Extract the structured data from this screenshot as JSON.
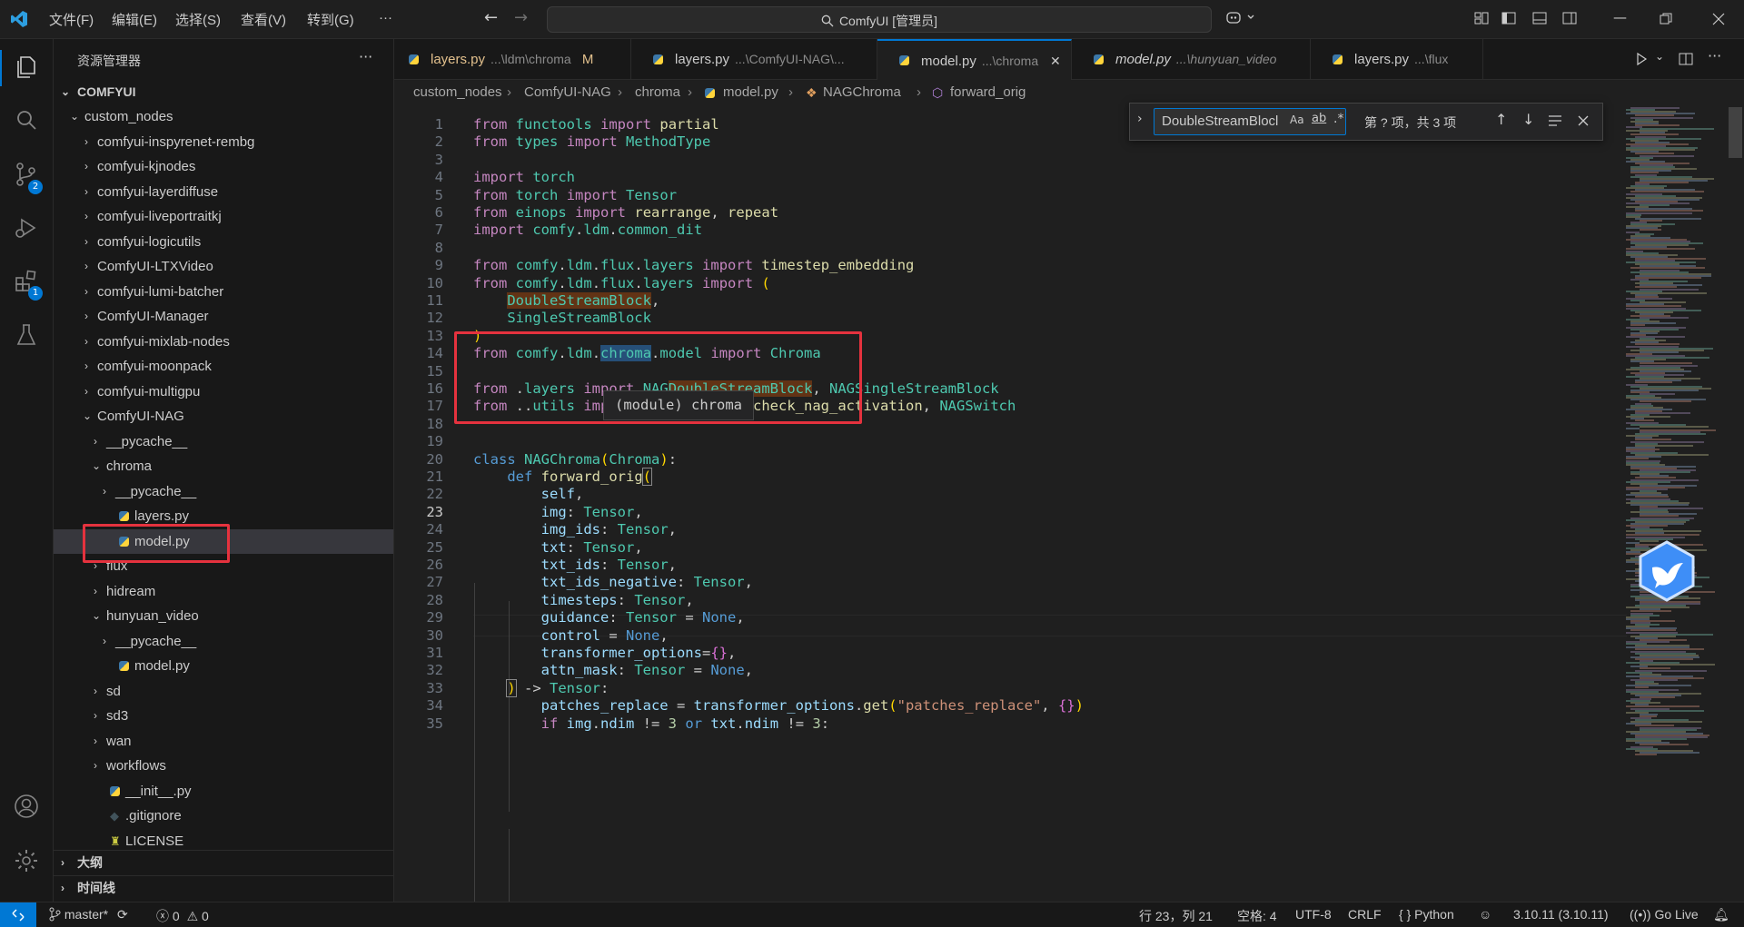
{
  "titlebar": {
    "menu": [
      "文件(F)",
      "编辑(E)",
      "选择(S)",
      "查看(V)",
      "转到(G)",
      "···"
    ],
    "command_center": "ComfyUI [管理员]"
  },
  "activitybar": {
    "scm_badge": "2",
    "extensions_badge": "1"
  },
  "sidebar": {
    "title": "资源管理器",
    "more": "···",
    "root": "COMFYUI",
    "items": [
      {
        "label": "custom_nodes",
        "depth": 1,
        "type": "folder-open"
      },
      {
        "label": "comfyui-inspyrenet-rembg",
        "depth": 2,
        "type": "folder"
      },
      {
        "label": "comfyui-kjnodes",
        "depth": 2,
        "type": "folder"
      },
      {
        "label": "comfyui-layerdiffuse",
        "depth": 2,
        "type": "folder"
      },
      {
        "label": "comfyui-liveportraitkj",
        "depth": 2,
        "type": "folder"
      },
      {
        "label": "comfyui-logicutils",
        "depth": 2,
        "type": "folder"
      },
      {
        "label": "ComfyUI-LTXVideo",
        "depth": 2,
        "type": "folder"
      },
      {
        "label": "comfyui-lumi-batcher",
        "depth": 2,
        "type": "folder"
      },
      {
        "label": "ComfyUI-Manager",
        "depth": 2,
        "type": "folder"
      },
      {
        "label": "comfyui-mixlab-nodes",
        "depth": 2,
        "type": "folder"
      },
      {
        "label": "comfyui-moonpack",
        "depth": 2,
        "type": "folder"
      },
      {
        "label": "comfyui-multigpu",
        "depth": 2,
        "type": "folder"
      },
      {
        "label": "ComfyUI-NAG",
        "depth": 2,
        "type": "folder-open"
      },
      {
        "label": "__pycache__",
        "depth": 3,
        "type": "folder"
      },
      {
        "label": "chroma",
        "depth": 3,
        "type": "folder-open"
      },
      {
        "label": "__pycache__",
        "depth": 4,
        "type": "folder"
      },
      {
        "label": "layers.py",
        "depth": 4,
        "type": "py"
      },
      {
        "label": "model.py",
        "depth": 4,
        "type": "py",
        "selected": true
      },
      {
        "label": "flux",
        "depth": 3,
        "type": "folder"
      },
      {
        "label": "hidream",
        "depth": 3,
        "type": "folder"
      },
      {
        "label": "hunyuan_video",
        "depth": 3,
        "type": "folder-open"
      },
      {
        "label": "__pycache__",
        "depth": 4,
        "type": "folder"
      },
      {
        "label": "model.py",
        "depth": 4,
        "type": "py"
      },
      {
        "label": "sd",
        "depth": 3,
        "type": "folder"
      },
      {
        "label": "sd3",
        "depth": 3,
        "type": "folder"
      },
      {
        "label": "wan",
        "depth": 3,
        "type": "folder"
      },
      {
        "label": "workflows",
        "depth": 3,
        "type": "folder"
      },
      {
        "label": "__init__.py",
        "depth": 3,
        "type": "py"
      },
      {
        "label": ".gitignore",
        "depth": 3,
        "type": "git"
      },
      {
        "label": "LICENSE",
        "depth": 3,
        "type": "license"
      }
    ],
    "outline": "大纲",
    "timeline": "时间线"
  },
  "tabs": [
    {
      "name": "layers.py",
      "path": "...\\ldm\\chroma",
      "marker": "M",
      "modified": true
    },
    {
      "name": "layers.py",
      "path": "...\\ComfyUI-NAG\\..."
    },
    {
      "name": "model.py",
      "path": "...\\chroma",
      "active": true,
      "close": "✕"
    },
    {
      "name": "model.py",
      "path": "...\\hunyuan_video",
      "italic": true
    },
    {
      "name": "layers.py",
      "path": "...\\flux"
    }
  ],
  "breadcrumb": [
    "custom_nodes",
    "ComfyUI-NAG",
    "chroma",
    "model.py",
    "NAGChroma",
    "forward_orig"
  ],
  "find": {
    "query": "DoubleStreamBlocl",
    "opt_case": "Aa",
    "opt_word": "ab",
    "opt_regex": ".*",
    "result": "第 ? 项，共 3 项"
  },
  "tooltip": "(module) chroma",
  "editor": {
    "current_line": 23,
    "line_numbers": [
      "1",
      "2",
      "3",
      "4",
      "5",
      "6",
      "7",
      "8",
      "9",
      "10",
      "11",
      "12",
      "13",
      "14",
      "15",
      "16",
      "17",
      "18",
      "19",
      "20",
      "21",
      "22",
      "23",
      "24",
      "25",
      "26",
      "27",
      "28",
      "29",
      "30",
      "31",
      "32",
      "33",
      "34",
      "35"
    ]
  },
  "statusbar": {
    "branch": "master*",
    "errors": "0",
    "warnings": "0",
    "position": "行 23，列 21",
    "indent": "空格: 4",
    "encoding": "UTF-8",
    "eol": "CRLF",
    "language": "Python",
    "interpreter": "3.10.11 (3.10.11)",
    "golive": "Go Live"
  }
}
